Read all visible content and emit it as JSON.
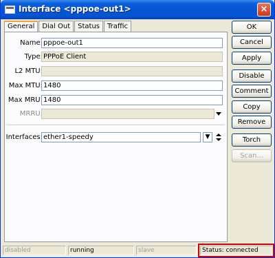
{
  "window": {
    "title": "Interface <pppoe-out1>",
    "close_label": "×"
  },
  "tabs": [
    {
      "label": "General",
      "active": true
    },
    {
      "label": "Dial Out",
      "active": false
    },
    {
      "label": "Status",
      "active": false
    },
    {
      "label": "Traffic",
      "active": false
    }
  ],
  "form": {
    "name": {
      "label": "Name:",
      "value": "pppoe-out1"
    },
    "type": {
      "label": "Type:",
      "value": "PPPoE Client"
    },
    "l2mtu": {
      "label": "L2 MTU:",
      "value": ""
    },
    "max_mtu": {
      "label": "Max MTU:",
      "value": "1480"
    },
    "max_mru": {
      "label": "Max MRU:",
      "value": "1480"
    },
    "mrru": {
      "label": "MRRU:",
      "value": ""
    },
    "interfaces": {
      "label": "Interfaces:",
      "value": "ether1-speedy",
      "combo_button": "▼"
    }
  },
  "buttons": {
    "ok": "OK",
    "cancel": "Cancel",
    "apply": "Apply",
    "disable": "Disable",
    "comment": "Comment",
    "copy": "Copy",
    "remove": "Remove",
    "torch": "Torch",
    "scan": "Scan..."
  },
  "statusbar": {
    "disabled": "disabled",
    "running": "running",
    "slave": "slave",
    "status": "Status: connected"
  },
  "colors": {
    "highlight": "#d00000",
    "title_bar": "#0654d6",
    "tab_accent": "#f1a33a"
  }
}
